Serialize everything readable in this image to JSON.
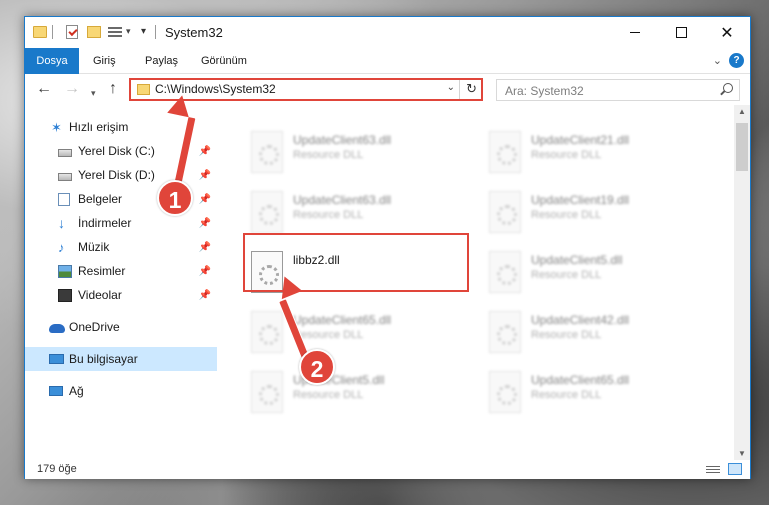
{
  "window": {
    "title": "System32"
  },
  "ribbon": {
    "tabs": [
      "Dosya",
      "Giriş",
      "Paylaş",
      "Görünüm"
    ]
  },
  "address": {
    "path": "C:\\Windows\\System32"
  },
  "search": {
    "placeholder": "Ara: System32"
  },
  "sidebar": {
    "items": [
      {
        "label": "Hızlı erişim",
        "icon": "star-icon"
      },
      {
        "label": "Yerel Disk (C:)",
        "icon": "drive-icon",
        "pinned": true
      },
      {
        "label": "Yerel Disk (D:)",
        "icon": "drive-icon",
        "pinned": true
      },
      {
        "label": "Belgeler",
        "icon": "documents-icon",
        "pinned": true
      },
      {
        "label": "İndirmeler",
        "icon": "downloads-icon",
        "pinned": true
      },
      {
        "label": "Müzik",
        "icon": "music-icon",
        "pinned": true
      },
      {
        "label": "Resimler",
        "icon": "pictures-icon",
        "pinned": true
      },
      {
        "label": "Videolar",
        "icon": "videos-icon",
        "pinned": true
      },
      {
        "label": "OneDrive",
        "icon": "onedrive-icon"
      },
      {
        "label": "Bu bilgisayar",
        "icon": "pc-icon",
        "selected": true
      },
      {
        "label": "Ağ",
        "icon": "network-icon"
      }
    ]
  },
  "files": [
    {
      "name": "UpdateClient63.dll",
      "type": "Resource DLL"
    },
    {
      "name": "UpdateClient21.dll",
      "type": "Resource DLL"
    },
    {
      "name": "UpdateClient63.dll",
      "type": "Resource DLL"
    },
    {
      "name": "UpdateClient19.dll",
      "type": "Resource DLL"
    },
    {
      "name": "libbz2.dll",
      "type": ""
    },
    {
      "name": "UpdateClient5.dll",
      "type": "Resource DLL"
    },
    {
      "name": "UpdateClient65.dll",
      "type": "Resource DLL"
    },
    {
      "name": "UpdateClient42.dll",
      "type": "Resource DLL"
    },
    {
      "name": "UpdateClient5.dll",
      "type": "Resource DLL"
    },
    {
      "name": "UpdateClient65.dll",
      "type": "Resource DLL"
    }
  ],
  "status": {
    "item_count": "179 öğe"
  },
  "annotations": {
    "step1": "1",
    "step2": "2",
    "color": "#e0453a"
  }
}
